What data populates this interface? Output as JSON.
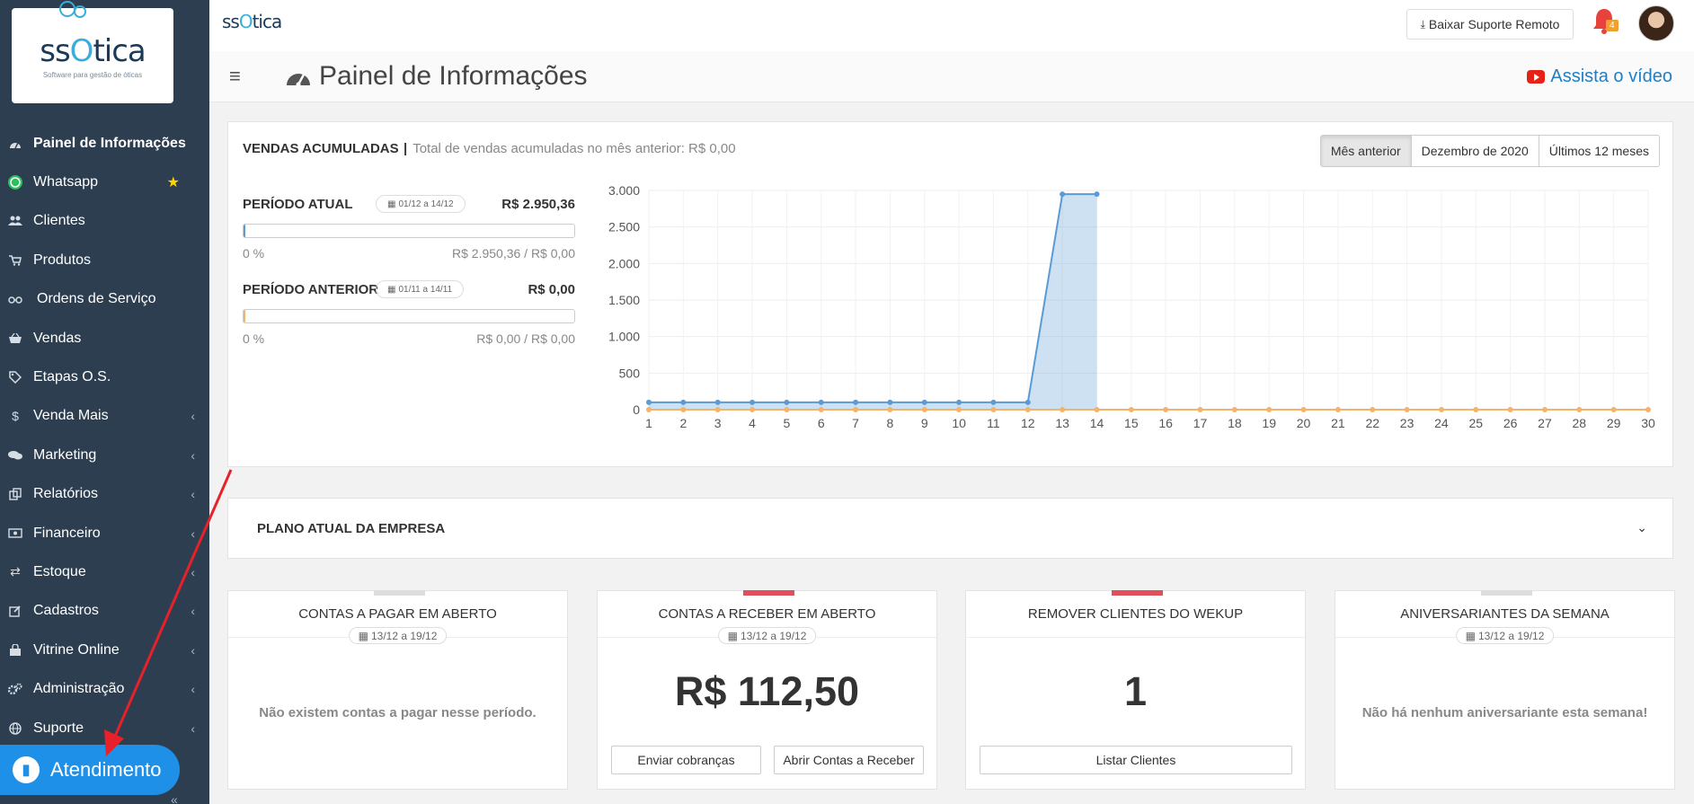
{
  "logo": {
    "word_pre": "ss",
    "word_o": "O",
    "word_post": "tica",
    "tagline": "Software para gestão de óticas"
  },
  "sidebar": {
    "items": [
      {
        "label": "Painel de Informações",
        "icon": "dashboard-icon"
      },
      {
        "label": "Whatsapp",
        "icon": "whatsapp-icon"
      },
      {
        "label": "Clientes",
        "icon": "users-icon"
      },
      {
        "label": "Produtos",
        "icon": "cart-icon"
      },
      {
        "label": "Ordens de Serviço",
        "icon": "glasses-icon"
      },
      {
        "label": "Vendas",
        "icon": "basket-icon"
      },
      {
        "label": "Etapas O.S.",
        "icon": "tag-icon"
      },
      {
        "label": "Venda Mais",
        "icon": "dollar-icon"
      },
      {
        "label": "Marketing",
        "icon": "comments-icon"
      },
      {
        "label": "Relatórios",
        "icon": "copy-icon"
      },
      {
        "label": "Financeiro",
        "icon": "money-icon"
      },
      {
        "label": "Estoque",
        "icon": "exchange-icon"
      },
      {
        "label": "Cadastros",
        "icon": "edit-icon"
      },
      {
        "label": "Vitrine Online",
        "icon": "shopping-bag-icon"
      },
      {
        "label": "Administração",
        "icon": "cogs-icon"
      },
      {
        "label": "Suporte",
        "icon": "globe-icon"
      }
    ],
    "atendimento_label": "Atendimento"
  },
  "topbar": {
    "mini_logo_pre": "ss",
    "mini_logo_o": "O",
    "mini_logo_post": "tica",
    "suporte_label": "Baixar Suporte Remoto",
    "notification_count": "4"
  },
  "header": {
    "title": "Painel de Informações",
    "video_link": "Assista o vídeo"
  },
  "sales": {
    "title": "VENDAS ACUMULADAS",
    "separator": "|",
    "subtitle": "Total de vendas acumuladas no mês anterior:  R$ 0,00",
    "period_buttons": [
      "Mês anterior",
      "Dezembro de 2020",
      "Últimos 12 meses"
    ],
    "current": {
      "label": "PERÍODO ATUAL",
      "date": "01/12 a 14/12",
      "value": "R$ 2.950,36",
      "pct": "0 %",
      "ratio": "R$ 2.950,36 / R$ 0,00",
      "progress": 0.005
    },
    "previous": {
      "label": "PERÍODO ANTERIOR",
      "date": "01/11 a 14/11",
      "value": "R$ 0,00",
      "pct": "0 %",
      "ratio": "R$ 0,00 / R$ 0,00",
      "progress": 0.005
    }
  },
  "colors": {
    "sidebar": "#2d3e50",
    "current": "#5b9bd5",
    "previous": "#f4b26b",
    "accent_red": "#e0505a"
  },
  "chart_data": {
    "type": "area",
    "x": [
      1,
      2,
      3,
      4,
      5,
      6,
      7,
      8,
      9,
      10,
      11,
      12,
      13,
      14,
      15,
      16,
      17,
      18,
      19,
      20,
      21,
      22,
      23,
      24,
      25,
      26,
      27,
      28,
      29,
      30
    ],
    "ylim": [
      0,
      3000
    ],
    "yticks": [
      "0",
      "500",
      "1.000",
      "1.500",
      "2.000",
      "2.500",
      "3.000"
    ],
    "ytick_values": [
      0,
      500,
      1000,
      1500,
      2000,
      2500,
      3000
    ],
    "grid": true,
    "series": [
      {
        "color": "#5b9bd5",
        "values": [
          100,
          100,
          100,
          100,
          100,
          100,
          100,
          100,
          100,
          100,
          100,
          100,
          2950,
          2950
        ]
      },
      {
        "color": "#f4b26b",
        "values": [
          0,
          0,
          0,
          0,
          0,
          0,
          0,
          0,
          0,
          0,
          0,
          0,
          0,
          0,
          0,
          0,
          0,
          0,
          0,
          0,
          0,
          0,
          0,
          0,
          0,
          0,
          0,
          0,
          0,
          0
        ]
      }
    ]
  },
  "plano": {
    "title": "PLANO ATUAL DA EMPRESA"
  },
  "cards": [
    {
      "title": "CONTAS A PAGAR EM ABERTO",
      "date": "13/12 a 19/12",
      "message": "Não existem contas a pagar nesse período.",
      "stripe": "#dddddd"
    },
    {
      "title": "CONTAS A RECEBER EM ABERTO",
      "date": "13/12 a 19/12",
      "value": "R$ 112,50",
      "btn1": "Enviar cobranças",
      "btn2": "Abrir Contas a Receber",
      "stripe": "#e0505a"
    },
    {
      "title": "REMOVER CLIENTES DO WEKUP",
      "value": "1",
      "btn": "Listar Clientes",
      "stripe": "#e0505a"
    },
    {
      "title": "ANIVERSARIANTES DA SEMANA",
      "date": "13/12 a 19/12",
      "message": "Não há nenhum aniversariante esta semana!",
      "stripe": "#dddddd"
    }
  ]
}
